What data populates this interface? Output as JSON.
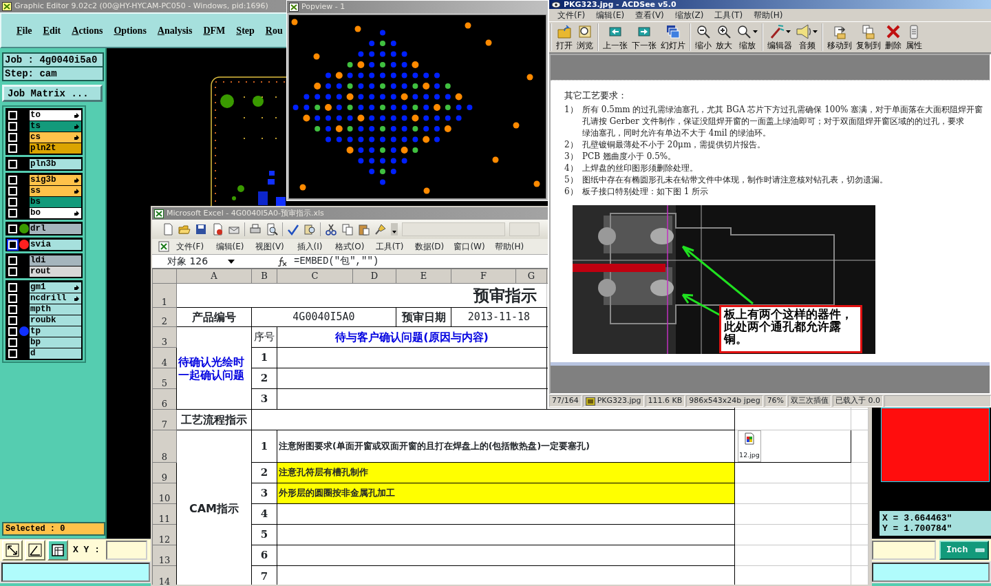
{
  "graphic_editor": {
    "title": "Graphic Editor 9.02c2 (00@HY-HYCAM-PC050 - Windows, pid:1696)",
    "menu": [
      "File",
      "Edit",
      "Actions",
      "Options",
      "Analysis",
      "DFM",
      "Step",
      "Rou"
    ],
    "job": "Job : 4g0040i5a0",
    "step": "Step: cam",
    "job_matrix_button": "Job Matrix ...",
    "layer_groups": [
      {
        "layers": [
          {
            "name": "to",
            "color": "#ffffff",
            "checked": false,
            "selected": false,
            "pointer": true
          },
          {
            "name": "ts",
            "color": "#139a7b",
            "checked": false,
            "selected": false,
            "pointer": true
          },
          {
            "name": "cs",
            "color": "#ffc24a",
            "checked": false,
            "selected": false,
            "pointer": true
          },
          {
            "name": "pln2t",
            "color": "#dba400",
            "checked": false,
            "selected": false,
            "pointer": false
          }
        ]
      },
      {
        "layers": [
          {
            "name": "pln3b",
            "color": "#a6e0dd",
            "checked": false,
            "selected": false,
            "pointer": false
          }
        ]
      },
      {
        "layers": [
          {
            "name": "sig3b",
            "color": "#ffc24a",
            "checked": false,
            "selected": false,
            "pointer": true
          },
          {
            "name": "ss",
            "color": "#ffc24a",
            "checked": false,
            "selected": false,
            "pointer": true
          },
          {
            "name": "bs",
            "color": "#139a7b",
            "checked": false,
            "selected": false,
            "pointer": false
          },
          {
            "name": "bo",
            "color": "#ffffff",
            "checked": false,
            "selected": false,
            "pointer": true
          }
        ]
      },
      {
        "layers": [
          {
            "name": "drl",
            "color": "#a5b5bd",
            "dot": {
              "color": "#3a9a00"
            },
            "checked": false,
            "selected": false,
            "pointer": false
          }
        ]
      },
      {
        "layers": [
          {
            "name": "svia",
            "color": "#a6e0dd",
            "dot": {
              "color": "#ff2020"
            },
            "checked": false,
            "selected": true,
            "pointer": false
          }
        ]
      },
      {
        "layers": [
          {
            "name": "ldi",
            "color": "#a5b5bd",
            "checked": false,
            "selected": false,
            "pointer": false
          },
          {
            "name": "rout",
            "color": "#d8d8d8",
            "checked": false,
            "selected": false,
            "pointer": false
          }
        ]
      },
      {
        "layers": [
          {
            "name": "gm1",
            "color": "#a6e0dd",
            "checked": false,
            "selected": false,
            "pointer": true
          },
          {
            "name": "ncdrill",
            "color": "#a6e0dd",
            "checked": false,
            "selected": false,
            "pointer": true
          },
          {
            "name": "mpth",
            "color": "#a6e0dd",
            "checked": false,
            "selected": false,
            "pointer": false
          },
          {
            "name": "roubk",
            "color": "#a6e0dd",
            "checked": false,
            "selected": false,
            "pointer": false
          },
          {
            "name": "tp",
            "color": "#a6e0dd",
            "dot": {
              "color": "#1030ff"
            },
            "checked": false,
            "selected": false,
            "pointer": false
          },
          {
            "name": "bp",
            "color": "#a6e0dd",
            "checked": false,
            "selected": false,
            "pointer": false
          },
          {
            "name": "d",
            "color": "#a6e0dd",
            "checked": false,
            "selected": false,
            "pointer": false
          }
        ]
      }
    ],
    "selected_count": "Selected : 0",
    "xy_label": "X Y :",
    "coordinates": [
      "X = 3.664463\"",
      "Y = 1.700784\""
    ],
    "units_button": "Inch"
  },
  "popview": {
    "title": "Popview - 1"
  },
  "excel": {
    "title": "Microsoft Excel - 4G0040I5A0-预审指示.xls",
    "menu": [
      "文件(F)",
      "编辑(E)",
      "视图(V)",
      "插入(I)",
      "格式(O)",
      "工具(T)",
      "数据(D)",
      "窗口(W)",
      "帮助(H)"
    ],
    "name_box": "对象 126",
    "formula": "=EMBED(\"包\",\"\")",
    "columns": [
      "A",
      "B",
      "C",
      "D",
      "E",
      "F",
      "G"
    ],
    "rows": [
      {
        "number": "1",
        "cells": [
          {
            "kind": "title",
            "text": "预审指示",
            "colspan": 7
          }
        ]
      },
      {
        "number": "2",
        "cells": [
          {
            "kind": "label",
            "text": "产品编号"
          },
          {
            "kind": "value",
            "text": "4G0040I5A0",
            "colspan": 3
          },
          {
            "kind": "label",
            "text": "预审日期"
          },
          {
            "kind": "value",
            "text": "2013-11-18",
            "colspan": 2
          }
        ]
      },
      {
        "number": "3",
        "cells": [
          {
            "kind": "side",
            "text": "待确认光绘时一起确认问题",
            "rowspan": 4
          },
          {
            "kind": "plain",
            "text": "序号"
          },
          {
            "kind": "question",
            "text": "待与客户确认问题(原因与内容)",
            "colspan": 5
          }
        ]
      },
      {
        "number": "4",
        "cells": [
          {
            "kind": "number",
            "text": "1"
          },
          {
            "kind": "blank",
            "colspan": 5
          }
        ]
      },
      {
        "number": "5",
        "cells": [
          {
            "kind": "number",
            "text": "2"
          },
          {
            "kind": "blank",
            "colspan": 5
          }
        ]
      },
      {
        "number": "6",
        "cells": [
          {
            "kind": "number",
            "text": "3"
          },
          {
            "kind": "blank",
            "colspan": 5
          }
        ]
      },
      {
        "number": "7",
        "cells": [
          {
            "kind": "label",
            "text": "工艺流程指示"
          },
          {
            "kind": "blank",
            "colspan": 7
          }
        ]
      },
      {
        "number": "8",
        "cells": [
          {
            "kind": "label",
            "text": "CAM指示",
            "rowspan": 7
          },
          {
            "kind": "number",
            "text": "1"
          },
          {
            "kind": "note",
            "text": "注意附图要求(单面开窗或双面开窗的且打在焊盘上的(包括散热盘)一定要塞孔)",
            "colspan": 6,
            "highlight": false
          },
          {
            "kind": "object",
            "text": "12.jpg"
          }
        ]
      },
      {
        "number": "9",
        "cells": [
          {
            "kind": "number",
            "text": "2"
          },
          {
            "kind": "note",
            "text": "注意孔符层有槽孔制作",
            "colspan": 6,
            "highlight": true
          }
        ]
      },
      {
        "number": "10",
        "cells": [
          {
            "kind": "number",
            "text": "3"
          },
          {
            "kind": "note",
            "text": "外形层的圆圈按非金属孔加工",
            "colspan": 6,
            "highlight": true
          }
        ]
      },
      {
        "number": "11",
        "cells": [
          {
            "kind": "number",
            "text": "4"
          },
          {
            "kind": "blank",
            "colspan": 6
          }
        ]
      },
      {
        "number": "12",
        "cells": [
          {
            "kind": "number",
            "text": "5"
          },
          {
            "kind": "blank",
            "colspan": 6
          }
        ]
      },
      {
        "number": "13",
        "cells": [
          {
            "kind": "number",
            "text": "6"
          },
          {
            "kind": "blank",
            "colspan": 6
          }
        ]
      },
      {
        "number": "14",
        "cells": [
          {
            "kind": "number",
            "text": "7"
          },
          {
            "kind": "blank",
            "colspan": 6
          }
        ]
      }
    ]
  },
  "acdsee": {
    "title": "PKG323.jpg - ACDSee v5.0",
    "menu": [
      "文件(F)",
      "编辑(E)",
      "查看(V)",
      "缩放(Z)",
      "工具(T)",
      "帮助(H)"
    ],
    "toolbar": [
      [
        {
          "kind": "open",
          "label": "打开",
          "dropdown": false
        },
        {
          "kind": "browse",
          "label": "浏览",
          "dropdown": false
        }
      ],
      [
        {
          "kind": "previous",
          "label": "上一张",
          "dropdown": false
        },
        {
          "kind": "next",
          "label": "下一张",
          "dropdown": false
        },
        {
          "kind": "slideshow",
          "label": "幻灯片",
          "dropdown": false
        }
      ],
      [
        {
          "kind": "zoom_out",
          "label": "缩小",
          "dropdown": false
        },
        {
          "kind": "zoom_in",
          "label": "放大",
          "dropdown": false
        },
        {
          "kind": "zoom",
          "label": "缩放",
          "dropdown": true
        }
      ],
      [
        {
          "kind": "editor",
          "label": "编辑器",
          "dropdown": true
        },
        {
          "kind": "audio",
          "label": "音频",
          "dropdown": true
        }
      ],
      [
        {
          "kind": "move",
          "label": "移动到",
          "dropdown": false
        },
        {
          "kind": "copy",
          "label": "复制到",
          "dropdown": false
        },
        {
          "kind": "delete",
          "label": "删除",
          "dropdown": false
        },
        {
          "kind": "properties",
          "label": "属性",
          "dropdown": false
        }
      ]
    ],
    "document": {
      "heading": "其它工艺要求：",
      "items": [
        {
          "number": "1）",
          "lines": [
            "所有 0.5mm 的过孔需绿油塞孔，尤其 BGA 芯片下方过孔需确保 100% 塞满，对于单面落在大面积阻焊开窗",
            "孔请按 Gerber 文件制作，保证没阻焊开窗的一面盖上绿油即可；对于双面阻焊开窗区域的的过孔，要求",
            "绿油塞孔，同时允许有单边不大于 4mil 的绿油环。"
          ]
        },
        {
          "number": "2）",
          "lines": [
            "孔壁镀铜最薄处不小于 20μm，需提供切片报告。"
          ]
        },
        {
          "number": "3）",
          "lines": [
            "PCB 翘曲度小于 0.5%。"
          ]
        },
        {
          "number": "4）",
          "lines": [
            "上焊盘的丝印图形须删除处理。"
          ]
        },
        {
          "number": "5）",
          "lines": [
            "图纸中存在有椭圆形孔未在钻带文件中体现，制作时请注意核对钻孔表，切勿遗漏。"
          ]
        },
        {
          "number": "6）",
          "lines": [
            "板子接口特别处理：如下图 1 所示"
          ]
        }
      ],
      "callout": "板上有两个这样的器件，此处两个通孔都允许露铜。"
    },
    "status_bar": [
      {
        "kind": "text",
        "text": "77/164"
      },
      {
        "kind": "file",
        "text": "PKG323.jpg"
      },
      {
        "kind": "text",
        "text": "111.6 KB"
      },
      {
        "kind": "text",
        "text": "986x543x24b jpeg"
      },
      {
        "kind": "text",
        "text": "76%"
      },
      {
        "kind": "text",
        "text": "双三次插值"
      },
      {
        "kind": "text",
        "text": "已载入于 0.0"
      }
    ]
  }
}
